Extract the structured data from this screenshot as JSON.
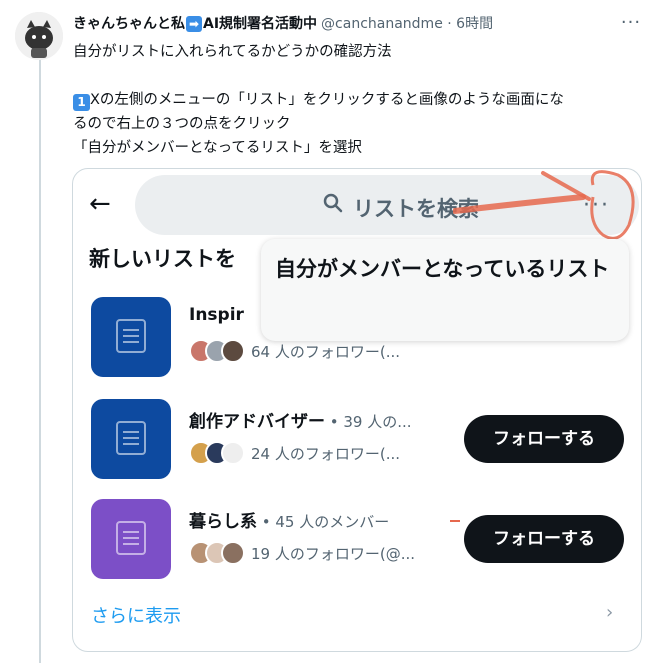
{
  "tweet": {
    "author_name_1": "きゃんちゃんと私",
    "author_name_2": "AI規制署名活動中",
    "handle": "@canchanandme",
    "time": "6時間",
    "text_line1": "自分がリストに入れられてるかどうかの確認方法",
    "text_line2": "Xの左側のメニューの「リスト」をクリックすると画像のような画面にな",
    "text_line3": "るので右上の３つの点をクリック",
    "text_line4": "「自分がメンバーとなってるリスト」を選択",
    "keycap": "1",
    "more_icon": "ellipsis-icon"
  },
  "screenshot": {
    "search_placeholder": "リストを検索",
    "section_title": "新しいリストを",
    "popup_text": "自分がメンバーとなっているリスト",
    "lists": [
      {
        "title": "Inspir",
        "meta": "",
        "followers": "64 人のフォロワー(...",
        "color": "#0d4aa0",
        "follow": ""
      },
      {
        "title": "創作アドバイザー",
        "meta": " • 39 人の...",
        "followers": "24 人のフォロワー(...",
        "color": "#0d4aa0",
        "follow": "フォローする"
      },
      {
        "title": "暮らし系",
        "meta": " • 45 人のメンバー",
        "followers": "19 人のフォロワー(@...",
        "color": "#7c4fc7",
        "follow": "フォローする"
      }
    ],
    "show_more": "さらに表示"
  },
  "colors": {
    "accent": "#1d9bf0",
    "annotation": "#e6684e"
  }
}
